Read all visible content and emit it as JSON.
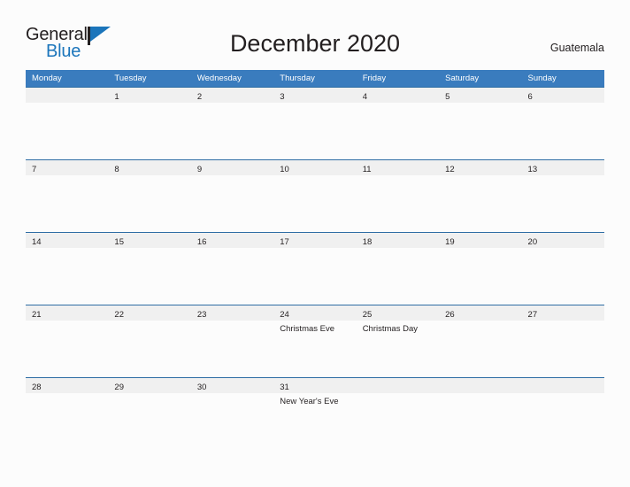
{
  "brand": {
    "word_one": "General",
    "word_two": "Blue",
    "flag_icon": "flag-triangle-icon"
  },
  "header": {
    "title": "December 2020",
    "country": "Guatemala"
  },
  "calendar": {
    "weekday_headers": [
      "Monday",
      "Tuesday",
      "Wednesday",
      "Thursday",
      "Friday",
      "Saturday",
      "Sunday"
    ],
    "weeks": [
      [
        {
          "day": "",
          "events": []
        },
        {
          "day": "1",
          "events": []
        },
        {
          "day": "2",
          "events": []
        },
        {
          "day": "3",
          "events": []
        },
        {
          "day": "4",
          "events": []
        },
        {
          "day": "5",
          "events": []
        },
        {
          "day": "6",
          "events": []
        }
      ],
      [
        {
          "day": "7",
          "events": []
        },
        {
          "day": "8",
          "events": []
        },
        {
          "day": "9",
          "events": []
        },
        {
          "day": "10",
          "events": []
        },
        {
          "day": "11",
          "events": []
        },
        {
          "day": "12",
          "events": []
        },
        {
          "day": "13",
          "events": []
        }
      ],
      [
        {
          "day": "14",
          "events": []
        },
        {
          "day": "15",
          "events": []
        },
        {
          "day": "16",
          "events": []
        },
        {
          "day": "17",
          "events": []
        },
        {
          "day": "18",
          "events": []
        },
        {
          "day": "19",
          "events": []
        },
        {
          "day": "20",
          "events": []
        }
      ],
      [
        {
          "day": "21",
          "events": []
        },
        {
          "day": "22",
          "events": []
        },
        {
          "day": "23",
          "events": []
        },
        {
          "day": "24",
          "events": [
            "Christmas Eve"
          ]
        },
        {
          "day": "25",
          "events": [
            "Christmas Day"
          ]
        },
        {
          "day": "26",
          "events": []
        },
        {
          "day": "27",
          "events": []
        }
      ],
      [
        {
          "day": "28",
          "events": []
        },
        {
          "day": "29",
          "events": []
        },
        {
          "day": "30",
          "events": []
        },
        {
          "day": "31",
          "events": [
            "New Year's Eve"
          ]
        },
        {
          "day": "",
          "events": []
        },
        {
          "day": "",
          "events": []
        },
        {
          "day": "",
          "events": []
        }
      ]
    ]
  },
  "colors": {
    "header_blue": "#3a7cbe",
    "row_divider_blue": "#2e6da4",
    "band_gray": "#f0f0f0",
    "brand_blue": "#1b75bb",
    "text_dark": "#231f20",
    "page_background": "#fcfcfc"
  }
}
